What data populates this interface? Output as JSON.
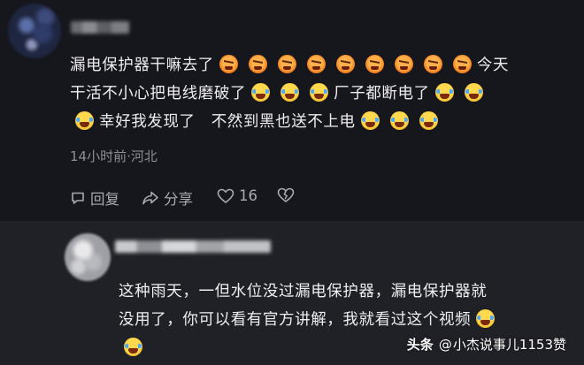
{
  "comments": [
    {
      "avatar": "blurred-avatar",
      "username": "",
      "lines": [
        [
          {
            "t": "text",
            "v": "漏电保护器干嘛去了"
          },
          {
            "t": "emoji",
            "v": "angry"
          },
          {
            "t": "emoji",
            "v": "angry"
          },
          {
            "t": "emoji",
            "v": "angry"
          },
          {
            "t": "emoji",
            "v": "angry"
          },
          {
            "t": "emoji",
            "v": "angry"
          },
          {
            "t": "emoji",
            "v": "angry"
          },
          {
            "t": "emoji",
            "v": "angry"
          },
          {
            "t": "emoji",
            "v": "angry"
          },
          {
            "t": "emoji",
            "v": "angry"
          },
          {
            "t": "text",
            "v": "今天"
          }
        ],
        [
          {
            "t": "text",
            "v": "干活不小心把电线磨破了"
          },
          {
            "t": "emoji",
            "v": "laugh"
          },
          {
            "t": "emoji",
            "v": "laugh"
          },
          {
            "t": "emoji",
            "v": "laugh"
          },
          {
            "t": "text",
            "v": "厂子都断电了"
          },
          {
            "t": "emoji",
            "v": "laugh"
          },
          {
            "t": "emoji",
            "v": "laugh"
          }
        ],
        [
          {
            "t": "emoji",
            "v": "laugh"
          },
          {
            "t": "text",
            "v": "幸好我发现了　不然到黑也送不上电"
          },
          {
            "t": "emoji",
            "v": "laugh"
          },
          {
            "t": "emoji",
            "v": "laugh"
          },
          {
            "t": "emoji",
            "v": "laugh"
          }
        ]
      ],
      "meta": "14小时前·河北",
      "actions": {
        "reply": "回复",
        "share": "分享",
        "like_count": "16"
      }
    },
    {
      "avatar": "blurred-avatar",
      "username": "",
      "lines": [
        [
          {
            "t": "text",
            "v": "这种雨天，一但水位没过漏电保护器，漏电保护器就"
          }
        ],
        [
          {
            "t": "text",
            "v": "没用了，你可以看有官方讲解，我就看过这个视频"
          },
          {
            "t": "emoji",
            "v": "laugh"
          }
        ],
        [
          {
            "t": "emoji",
            "v": "laugh"
          }
        ]
      ]
    }
  ],
  "watermark": {
    "logo": "头条",
    "at": "@",
    "handle": "小杰说事儿1153赞"
  },
  "colors": {
    "background": "#16171c",
    "reply_panel": "#202127",
    "text": "#eeeef0",
    "muted": "#8d8e95"
  }
}
